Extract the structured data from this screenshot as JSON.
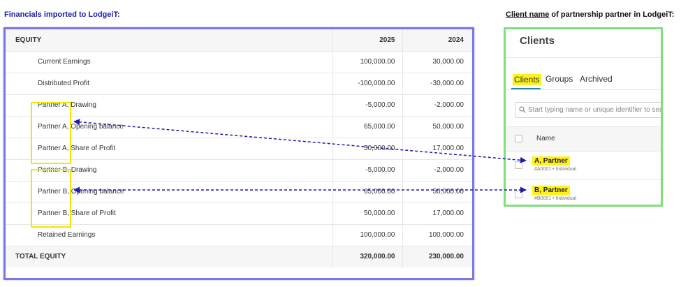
{
  "captions": {
    "left": "Financials imported to LodgeiT:",
    "right_underlined": "Client name",
    "right_rest": " of partnership partner in LodgeiT:"
  },
  "financials": {
    "headers": [
      "EQUITY",
      "2025",
      "2024"
    ],
    "rows": [
      {
        "label": "Current Earnings",
        "v2025": "100,000.00",
        "v2024": "30,000.00"
      },
      {
        "label": "Distributed Profit",
        "v2025": "-100,000.00",
        "v2024": "-30,000.00"
      },
      {
        "label": "Partner A, Drawing",
        "v2025": "-5,000.00",
        "v2024": "-2,000.00"
      },
      {
        "label": "Partner A, Opening balance",
        "v2025": "65,000.00",
        "v2024": "50,000.00"
      },
      {
        "label": "Partner A, Share of Profit",
        "v2025": "50,000.00",
        "v2024": "17,000.00"
      },
      {
        "label": "Partner B, Drawing",
        "v2025": "-5,000.00",
        "v2024": "-2,000.00"
      },
      {
        "label": "Partner B, Opening balance",
        "v2025": "65,000.00",
        "v2024": "50,000.00"
      },
      {
        "label": "Partner B, Share of Profit",
        "v2025": "50,000.00",
        "v2024": "17,000.00"
      },
      {
        "label": "Retained Earnings",
        "v2025": "100,000.00",
        "v2024": "100,000.00"
      }
    ],
    "total": {
      "label": "TOTAL EQUITY",
      "v2025": "320,000.00",
      "v2024": "230,000.00"
    }
  },
  "clients": {
    "title": "Clients",
    "tabs": [
      "Clients",
      "Groups",
      "Archived"
    ],
    "active_tab": "Clients",
    "search_placeholder": "Start typing name or unique identifier to search",
    "column_header": "Name",
    "items": [
      {
        "name": "A, Partner",
        "sub": "#A0001 • Individual"
      },
      {
        "name": "B, Partner",
        "sub": "#B0001 • Individual"
      }
    ]
  },
  "colors": {
    "highlight": "#fff21a",
    "arrow": "#1c1ca8",
    "financials_border": "#7c76e4",
    "clients_border": "#7fe07a"
  }
}
